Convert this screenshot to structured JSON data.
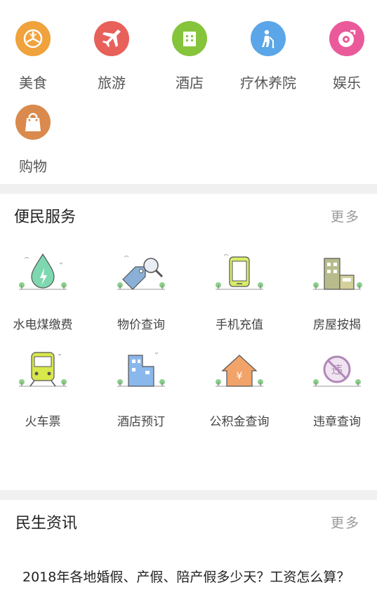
{
  "categories": [
    {
      "label": "美食",
      "icon": "food-icon",
      "color": "#f0a23c"
    },
    {
      "label": "旅游",
      "icon": "airplane-icon",
      "color": "#e8605a"
    },
    {
      "label": "酒店",
      "icon": "hotel-icon",
      "color": "#86c43c"
    },
    {
      "label": "疗休养院",
      "icon": "elderly-icon",
      "color": "#5aa6e8"
    },
    {
      "label": "娱乐",
      "icon": "music-disc-icon",
      "color": "#ea5a9a"
    },
    {
      "label": "购物",
      "icon": "shopping-bag-icon",
      "color": "#d98a4c"
    }
  ],
  "services": {
    "title": "便民服务",
    "more": "更多",
    "items": [
      {
        "label": "水电煤缴费",
        "icon": "water-drop-icon"
      },
      {
        "label": "物价查询",
        "icon": "price-tag-search-icon"
      },
      {
        "label": "手机充值",
        "icon": "mobile-phone-icon"
      },
      {
        "label": "房屋按揭",
        "icon": "house-building-icon"
      },
      {
        "label": "火车票",
        "icon": "train-icon"
      },
      {
        "label": "酒店预订",
        "icon": "hotel-building-icon"
      },
      {
        "label": "公积金查询",
        "icon": "house-yuan-icon"
      },
      {
        "label": "违章查询",
        "icon": "violation-sign-icon"
      }
    ]
  },
  "news": {
    "title": "民生资讯",
    "more": "更多",
    "items": [
      {
        "title": "2018年各地婚假、产假、陪产假多少天？工资怎么算？"
      }
    ]
  }
}
